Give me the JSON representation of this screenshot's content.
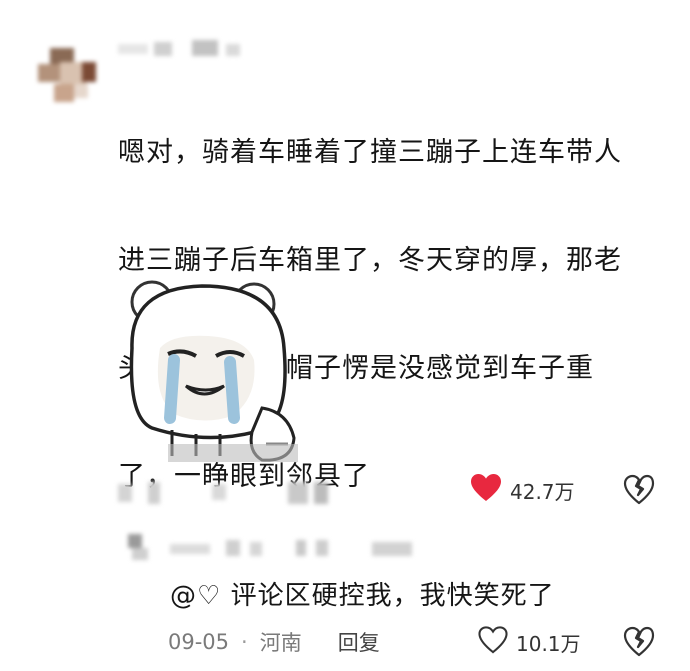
{
  "comment": {
    "text_lines": [
      "嗯对，骑着车睡着了撞三蹦子上连车带人",
      "进三蹦子后车箱里了，冬天穿的厚，那老",
      "头戴个封闭式帽子愣是没感觉到车子重",
      "了，一睁眼到邻县了"
    ],
    "likes": "42.7万",
    "like_color": "#e8283f",
    "sticker_icon": "crying-bear-sticker"
  },
  "reply": {
    "text": "@♡ 评论区硬控我，我快笑死了",
    "date": "09-05",
    "separator": "·",
    "location": "河南",
    "reply_label": "回复",
    "likes": "10.1万"
  },
  "icons": {
    "heart_filled": "heart-filled-icon",
    "heart_outline": "heart-outline-icon",
    "broken_heart": "broken-heart-icon"
  }
}
